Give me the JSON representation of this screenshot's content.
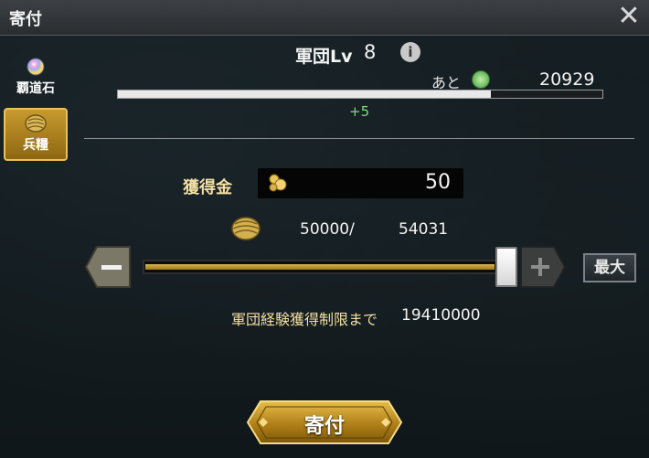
{
  "window": {
    "title": "寄付",
    "close_icon": "close-icon"
  },
  "sidebar": {
    "items": [
      {
        "label": "覇道石",
        "icon": "gem-icon",
        "selected": false
      },
      {
        "label": "兵糧",
        "icon": "provisions-icon",
        "selected": true
      }
    ]
  },
  "level": {
    "label": "軍団Lv",
    "value": "8",
    "info_icon": "info-icon",
    "remaining_label": "あと",
    "remaining_value": "20929",
    "progress_fraction": 0.77,
    "gain": "+5"
  },
  "gold": {
    "label": "獲得金",
    "value": "50",
    "icon": "gold-coins-icon"
  },
  "provisions": {
    "current": "50000/",
    "max": "54031",
    "icon": "provisions-icon"
  },
  "slider": {
    "fraction": 0.96,
    "minus_symbol": "−",
    "plus_symbol": "+",
    "max_label": "最大"
  },
  "limit": {
    "label": "軍団経験獲得制限まで",
    "value": "19410000"
  },
  "donate_button": {
    "label": "寄付"
  },
  "colors": {
    "accent_gold": "#d9b547",
    "gain_green": "#7fd97f",
    "label_cream": "#f3dfa2"
  }
}
